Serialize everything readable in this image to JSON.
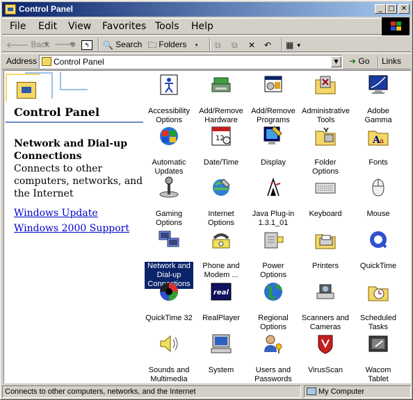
{
  "window": {
    "title": "Control Panel"
  },
  "menu": [
    "File",
    "Edit",
    "View",
    "Favorites",
    "Tools",
    "Help"
  ],
  "toolbar": {
    "back": "Back",
    "search": "Search",
    "folders": "Folders"
  },
  "address": {
    "label": "Address",
    "value": "Control Panel",
    "go": "Go",
    "links": "Links"
  },
  "sidebar": {
    "title": "Control Panel",
    "heading": "Network and Dial-up Connections",
    "description": "Connects to other computers, networks, and the Internet",
    "links": [
      "Windows Update",
      "Windows 2000 Support"
    ]
  },
  "icons": [
    {
      "label": "Accessibility Options",
      "icon": "accessibility-icon"
    },
    {
      "label": "Add/Remove Hardware",
      "icon": "add-remove-hardware-icon"
    },
    {
      "label": "Add/Remove Programs",
      "icon": "add-remove-programs-icon"
    },
    {
      "label": "Administrative Tools",
      "icon": "administrative-tools-icon"
    },
    {
      "label": "Adobe Gamma",
      "icon": "adobe-gamma-icon"
    },
    {
      "label": "Automatic Updates",
      "icon": "automatic-updates-icon"
    },
    {
      "label": "Date/Time",
      "icon": "date-time-icon"
    },
    {
      "label": "Display",
      "icon": "display-icon"
    },
    {
      "label": "Folder Options",
      "icon": "folder-options-icon"
    },
    {
      "label": "Fonts",
      "icon": "fonts-icon"
    },
    {
      "label": "Gaming Options",
      "icon": "gaming-options-icon"
    },
    {
      "label": "Internet Options",
      "icon": "internet-options-icon"
    },
    {
      "label": "Java Plug-in 1.3.1_01",
      "icon": "java-plugin-icon"
    },
    {
      "label": "Keyboard",
      "icon": "keyboard-icon"
    },
    {
      "label": "Mouse",
      "icon": "mouse-icon"
    },
    {
      "label": "Network and Dial-up Connections",
      "icon": "network-connections-icon",
      "selected": true
    },
    {
      "label": "Phone and Modem ...",
      "icon": "phone-modem-icon"
    },
    {
      "label": "Power Options",
      "icon": "power-options-icon"
    },
    {
      "label": "Printers",
      "icon": "printers-icon"
    },
    {
      "label": "QuickTime",
      "icon": "quicktime-icon"
    },
    {
      "label": "QuickTime 32",
      "icon": "quicktime-32-icon"
    },
    {
      "label": "RealPlayer",
      "icon": "realplayer-icon"
    },
    {
      "label": "Regional Options",
      "icon": "regional-options-icon"
    },
    {
      "label": "Scanners and Cameras",
      "icon": "scanners-cameras-icon"
    },
    {
      "label": "Scheduled Tasks",
      "icon": "scheduled-tasks-icon"
    },
    {
      "label": "Sounds and Multimedia",
      "icon": "sounds-multimedia-icon"
    },
    {
      "label": "System",
      "icon": "system-icon"
    },
    {
      "label": "Users and Passwords",
      "icon": "users-passwords-icon"
    },
    {
      "label": "VirusScan",
      "icon": "virusscan-icon"
    },
    {
      "label": "Wacom Tablet",
      "icon": "wacom-tablet-icon"
    }
  ],
  "status": {
    "left": "Connects to other computers, networks, and the Internet",
    "right": "My Computer"
  },
  "colors": {
    "titlebar_start": "#0a246a",
    "titlebar_end": "#a6caf0",
    "selection": "#0a246a",
    "link": "#0000cc",
    "face": "#d4d0c8"
  }
}
